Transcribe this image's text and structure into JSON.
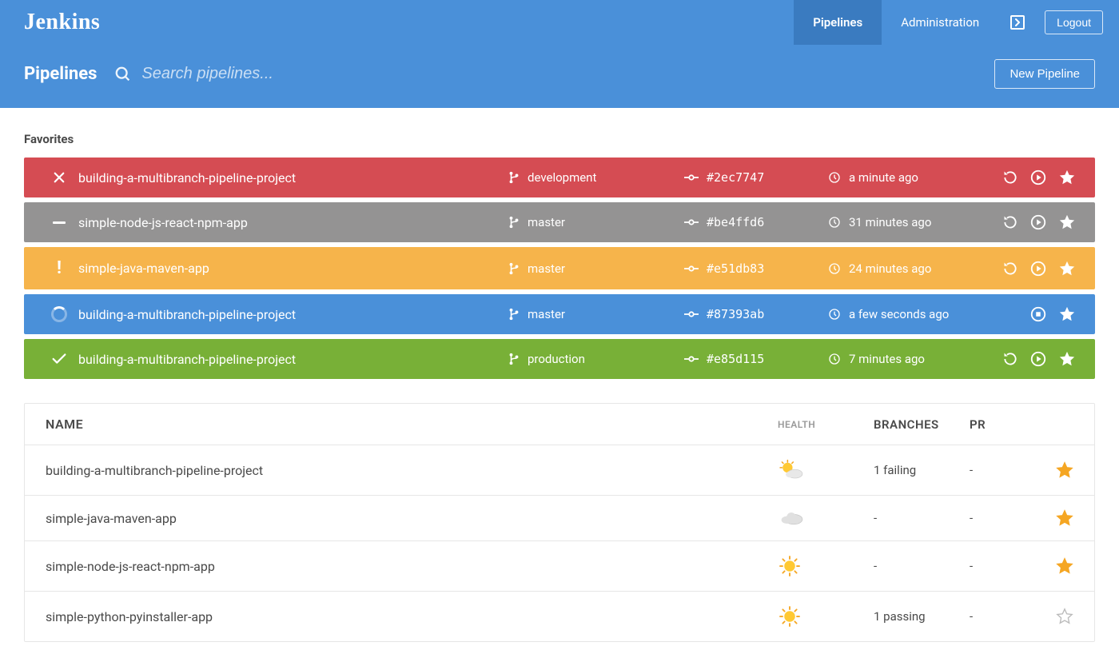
{
  "brand": "Jenkins",
  "nav": {
    "pipelines": "Pipelines",
    "administration": "Administration",
    "logout": "Logout"
  },
  "header": {
    "title": "Pipelines",
    "search_placeholder": "Search pipelines...",
    "new_button": "New Pipeline"
  },
  "favorites_label": "Favorites",
  "favorites": [
    {
      "status": "failed",
      "color": "red",
      "name": "building-a-multibranch-pipeline-project",
      "branch": "development",
      "commit": "#2ec7747",
      "time": "a minute ago",
      "running": false
    },
    {
      "status": "aborted",
      "color": "gray",
      "name": "simple-node-js-react-npm-app",
      "branch": "master",
      "commit": "#be4ffd6",
      "time": "31 minutes ago",
      "running": false
    },
    {
      "status": "unstable",
      "color": "orange",
      "name": "simple-java-maven-app",
      "branch": "master",
      "commit": "#e51db83",
      "time": "24 minutes ago",
      "running": false
    },
    {
      "status": "running",
      "color": "blue",
      "name": "building-a-multibranch-pipeline-project",
      "branch": "master",
      "commit": "#87393ab",
      "time": "a few seconds ago",
      "running": true
    },
    {
      "status": "passed",
      "color": "green",
      "name": "building-a-multibranch-pipeline-project",
      "branch": "production",
      "commit": "#e85d115",
      "time": "7 minutes ago",
      "running": false
    }
  ],
  "table": {
    "headers": {
      "name": "NAME",
      "health": "HEALTH",
      "branches": "BRANCHES",
      "pr": "PR"
    },
    "rows": [
      {
        "name": "building-a-multibranch-pipeline-project",
        "health": "partly",
        "branches": "1 failing",
        "pr": "-",
        "favorite": true
      },
      {
        "name": "simple-java-maven-app",
        "health": "cloudy",
        "branches": "-",
        "pr": "-",
        "favorite": true
      },
      {
        "name": "simple-node-js-react-npm-app",
        "health": "sunny",
        "branches": "-",
        "pr": "-",
        "favorite": true
      },
      {
        "name": "simple-python-pyinstaller-app",
        "health": "sunny",
        "branches": "1 passing",
        "pr": "-",
        "favorite": false
      }
    ]
  }
}
